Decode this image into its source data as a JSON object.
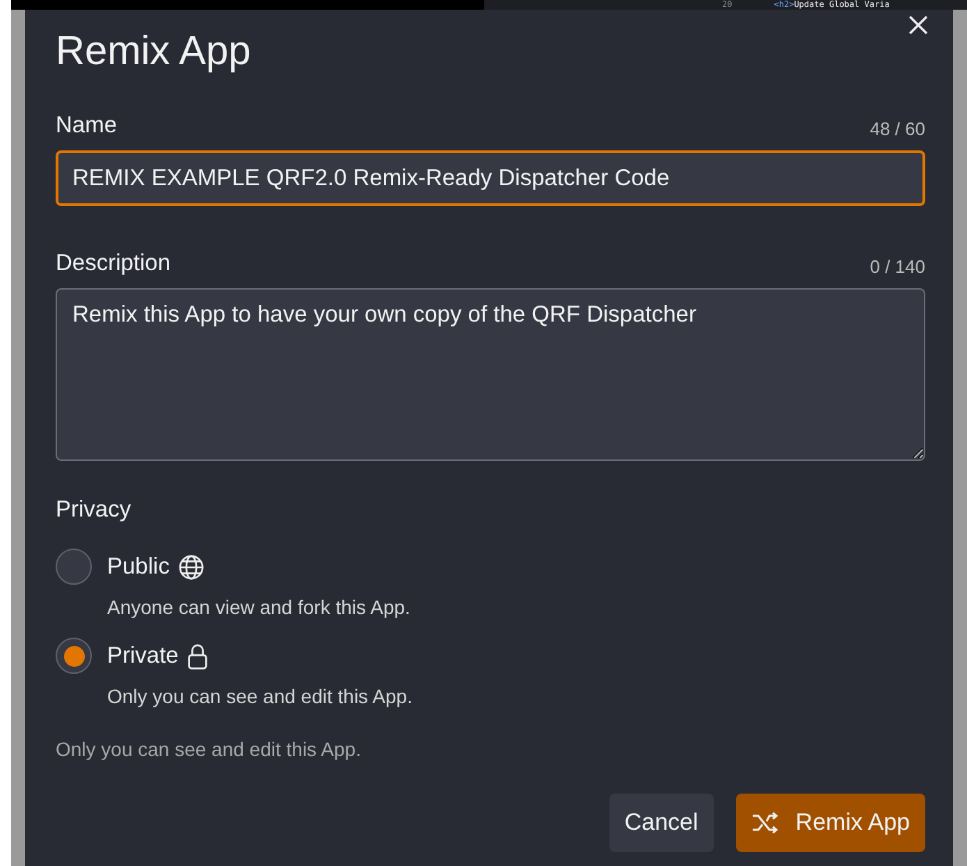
{
  "background_code": {
    "line_number": "20",
    "tag": "<h2>",
    "text": "Update Global Varia"
  },
  "dialog": {
    "title": "Remix App",
    "name_field": {
      "label": "Name",
      "counter": "48 / 60",
      "value": "REMIX EXAMPLE QRF2.0 Remix-Ready Dispatcher Code",
      "focused": true
    },
    "description_field": {
      "label": "Description",
      "counter": "0 / 140",
      "value": "Remix this App to have your own copy of the QRF Dispatcher",
      "focused": false
    },
    "privacy": {
      "label": "Privacy",
      "options": [
        {
          "label": "Public",
          "description": "Anyone can view and fork this App.",
          "kind": "globe",
          "selected": false
        },
        {
          "label": "Private",
          "description": "Only you can see and edit this App.",
          "kind": "lock",
          "selected": true
        }
      ],
      "note": "Only you can see and edit this App."
    },
    "buttons": [
      {
        "label": "Cancel",
        "kind": "secondary"
      },
      {
        "label": "Remix App",
        "kind": "primary"
      }
    ]
  }
}
